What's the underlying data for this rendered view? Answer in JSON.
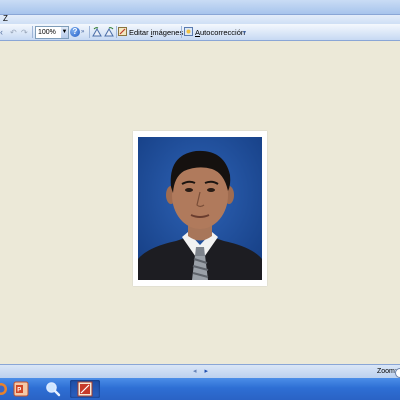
{
  "menubar": {
    "items": [
      "Z"
    ]
  },
  "toolbar": {
    "zoom_value": "100%",
    "edit_images_label_pre": "Editar ",
    "edit_images_label_ul": "i",
    "edit_images_label_post": "mágenes...",
    "autocorrect_label_ul": "A",
    "autocorrect_label_post": "utocorrección"
  },
  "statusbar": {
    "zoom_label": "Zoom:"
  },
  "taskbar": {
    "buttons": [
      "firefox-icon",
      "powerpoint-icon",
      "search-icon",
      "picture-manager-icon"
    ]
  },
  "colors": {
    "photo_background": "#1f4f9c",
    "viewer_background": "#ece9d8"
  }
}
